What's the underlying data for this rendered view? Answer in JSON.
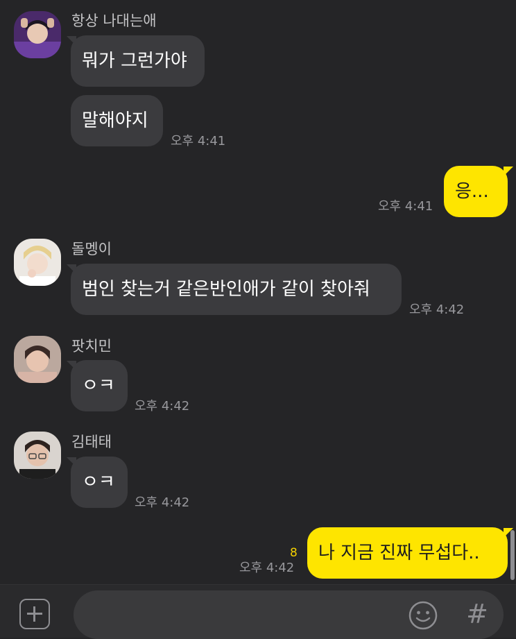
{
  "messages": [
    {
      "sender": "항상 나대는애",
      "bubbles": [
        "뭐가 그런가야",
        "말해야지"
      ],
      "time": "오후 4:41"
    },
    {
      "mine": true,
      "text": "응...",
      "time": "오후 4:41"
    },
    {
      "sender": "돌멩이",
      "text": "범인 찾는거 같은반인애가 같이 찾아줘",
      "time": "오후 4:42"
    },
    {
      "sender": "팟치민",
      "text": "ㅇㅋ",
      "time": "오후 4:42"
    },
    {
      "sender": "김태태",
      "text": "ㅇㅋ",
      "time": "오후 4:42"
    },
    {
      "mine": true,
      "text": "나 지금 진짜 무섭다..",
      "time": "오후 4:42",
      "unread": "8"
    }
  ],
  "input": {
    "placeholder": ""
  },
  "icons": {
    "attach": "plus-square-icon",
    "emoji": "smiley-icon",
    "hashtag": "hashtag-icon"
  },
  "colors": {
    "background": "#252527",
    "bubble_in": "#3b3b3e",
    "bubble_out": "#fee500",
    "unread": "#f4d000"
  }
}
